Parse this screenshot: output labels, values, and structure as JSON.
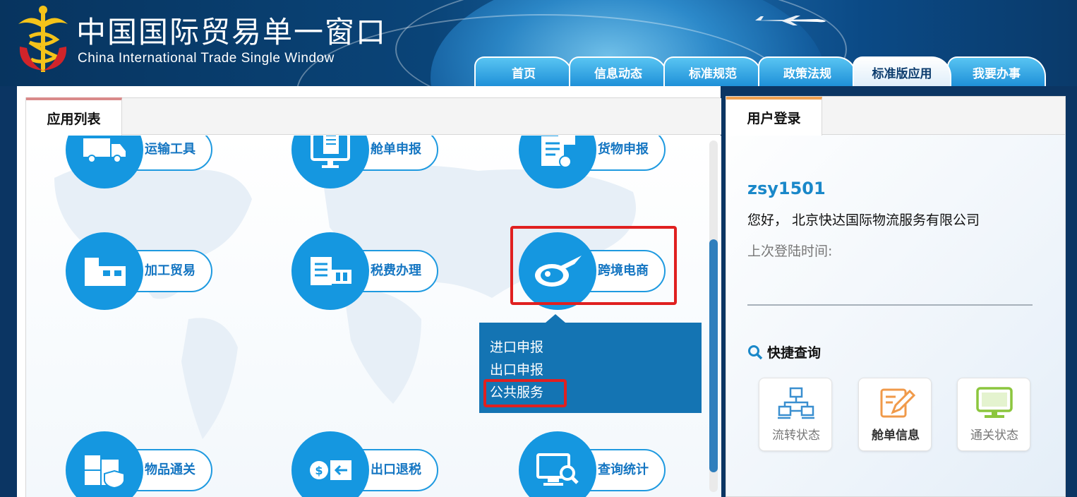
{
  "header": {
    "title_cn": "中国国际贸易单一窗口",
    "title_en": "China International Trade Single  Window"
  },
  "nav": {
    "tabs": [
      {
        "label": "首页",
        "active": false
      },
      {
        "label": "信息动态",
        "active": false
      },
      {
        "label": "标准规范",
        "active": false
      },
      {
        "label": "政策法规",
        "active": false
      },
      {
        "label": "标准版应用",
        "active": true
      },
      {
        "label": "我要办事",
        "active": false
      }
    ]
  },
  "app_list": {
    "title": "应用列表",
    "apps": [
      {
        "label": "运输工具",
        "icon": "truck-icon"
      },
      {
        "label": "舱单申报",
        "icon": "monitor-document-icon"
      },
      {
        "label": "货物申报",
        "icon": "cargo-checklist-icon"
      },
      {
        "label": "加工贸易",
        "icon": "factory-icon"
      },
      {
        "label": "税费办理",
        "icon": "tax-document-icon"
      },
      {
        "label": "跨境电商",
        "icon": "globe-plane-icon"
      },
      {
        "label": "物品通关",
        "icon": "package-shield-icon"
      },
      {
        "label": "出口退税",
        "icon": "money-return-icon"
      },
      {
        "label": "查询统计",
        "icon": "monitor-search-icon"
      }
    ],
    "popup_items": [
      "进口申报",
      "出口申报",
      "公共服务"
    ]
  },
  "login": {
    "title": "用户登录",
    "username": "zsy1501",
    "greeting": "您好，  北京快达国际物流服务有限公司",
    "last_login": "上次登陆时间:",
    "quick_title": "快捷查询",
    "quick_items": [
      {
        "label": "流转状态",
        "icon": "network-flow-icon"
      },
      {
        "label": "舱单信息",
        "icon": "edit-note-icon"
      },
      {
        "label": "通关状态",
        "icon": "monitor-icon"
      }
    ]
  },
  "colors": {
    "accent": "#1597e0",
    "highlight": "#e02020",
    "popup": "#1474b3"
  }
}
